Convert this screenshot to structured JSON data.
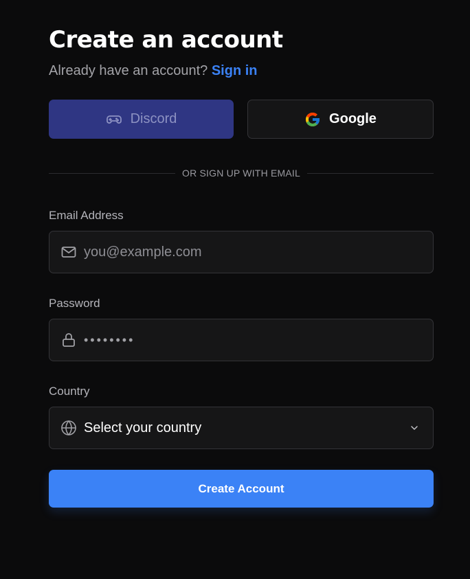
{
  "header": {
    "title": "Create an account",
    "subtitle_prefix": "Already have an account?",
    "signin_link": "Sign in"
  },
  "social": {
    "discord_label": "Discord",
    "discord_icon": "gamepad-icon",
    "google_label": "Google",
    "google_icon": "google-g-icon"
  },
  "divider_text": "OR SIGN UP WITH EMAIL",
  "form": {
    "email": {
      "label": "Email Address",
      "placeholder": "you@example.com",
      "value": "",
      "icon": "mail-icon"
    },
    "password": {
      "label": "Password",
      "value": "password",
      "icon": "lock-icon"
    },
    "country": {
      "label": "Country",
      "selected": "Select your country",
      "icon": "globe-icon",
      "dropdown_icon": "chevron-down-icon"
    },
    "submit_label": "Create Account"
  },
  "colors": {
    "background": "#0b0b0c",
    "accent": "#3b82f6",
    "discord": "#2f3683",
    "field_bg": "#161617",
    "border": "#343438"
  }
}
